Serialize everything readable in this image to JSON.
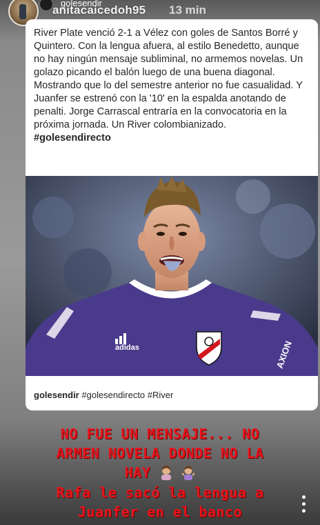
{
  "story": {
    "username": "anitacaicedoh95",
    "time": "13 min"
  },
  "post": {
    "account": "golesendir",
    "caption": "River Plate venció 2-1 a Vélez con goles de Santos Borré y Quintero. Con la lengua afuera, al estilo Benedetto, aunque no hay ningún mensaje subliminal, no armemos novelas. Un golazo picando el balón luego de una buena diagonal. Mostrando que lo del semestre anterior no fue casualidad. Y Juanfer se estrenó con la '10' en la espalda anotando de penalti. Jorge Carrascal entraría en la convocatoria en la próxima jornada. Un River colombianizado.",
    "hashtag": "#golesendirecto",
    "footer_user": "golesendir",
    "footer_tags": "#golesendirecto #River",
    "jersey_brand": "adidas",
    "sponsor": "AXION"
  },
  "overlay": {
    "line1": "NO FUE UN MENSAJE... NO",
    "line2": "ARMEN NOVELA DONDE NO LA",
    "line3": "HAY",
    "line4": "Rafa le sacó la lengua a",
    "line5": "Juanfer en el banco"
  },
  "colors": {
    "overlay_text": "#e8141c",
    "jersey": "#4a3a8c"
  }
}
